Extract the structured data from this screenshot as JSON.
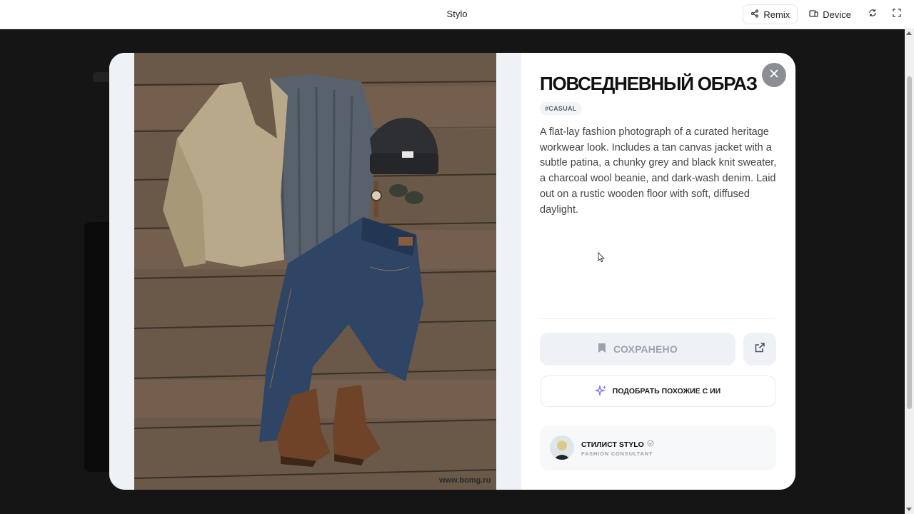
{
  "window": {
    "title": "Stylo",
    "remix_label": "Remix",
    "device_label": "Device"
  },
  "look": {
    "title": "ПОВСЕДНЕВНЫЙ ОБРАЗ",
    "tag": "#CASUAL",
    "description": "A flat-lay fashion photograph of a curated heritage workwear look. Includes a tan canvas jacket with a subtle patina, a chunky grey and black knit sweater, a charcoal wool beanie, and dark-wash denim. Laid out on a rustic wooden floor with soft, diffused daylight.",
    "watermark": "www.bomg.ru"
  },
  "actions": {
    "saved_label": "СОХРАНЕНО",
    "ai_match_label": "ПОДОБРАТЬ ПОХОЖИЕ С ИИ"
  },
  "stylist": {
    "name": "СТИЛИСТ STYLO",
    "role": "FASHION CONSULTANT"
  },
  "icons": {
    "close": "close-icon",
    "bookmark": "bookmark-icon",
    "share": "external-link-icon",
    "sparkles": "sparkles-icon",
    "verified": "verified-icon",
    "remix": "remix-icon",
    "device": "device-icon",
    "refresh": "refresh-icon",
    "fullscreen": "fullscreen-icon"
  },
  "colors": {
    "accent_ai": "#7b6cf6",
    "muted_text": "#9aa3ad",
    "close_button": "#8b8f95"
  }
}
